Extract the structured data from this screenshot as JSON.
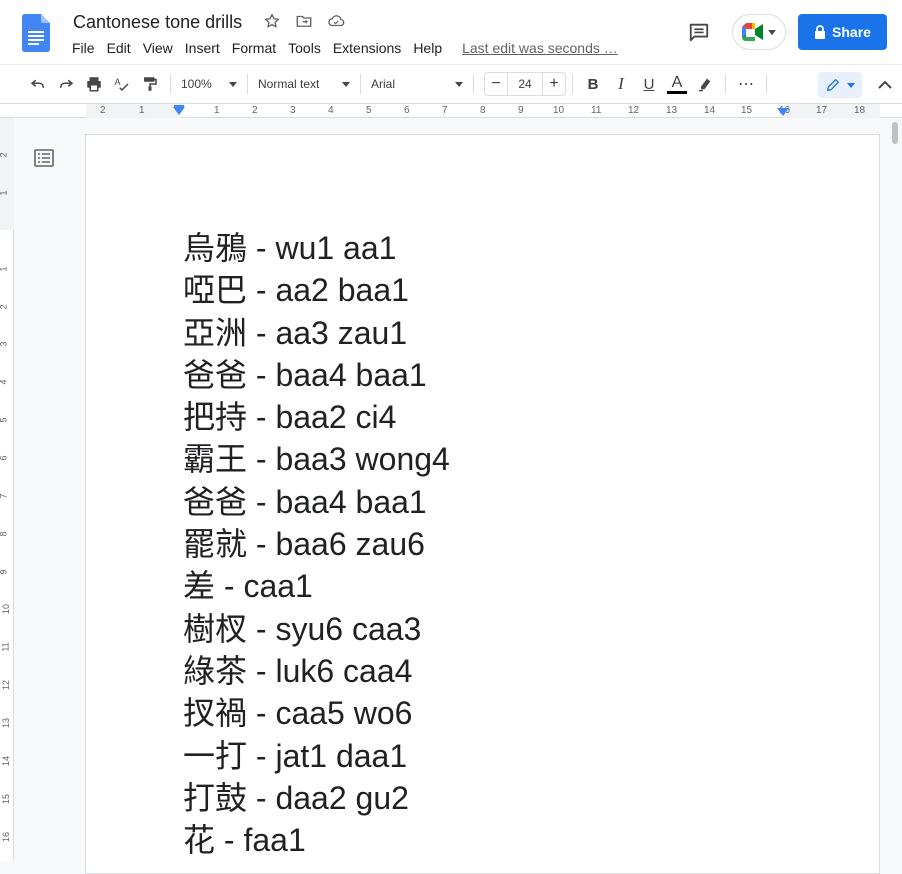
{
  "doc": {
    "title": "Cantonese tone drills",
    "last_edit": "Last edit was seconds …"
  },
  "menu": [
    "File",
    "Edit",
    "View",
    "Insert",
    "Format",
    "Tools",
    "Extensions",
    "Help"
  ],
  "header": {
    "share_label": "Share",
    "icons": [
      "star-icon",
      "move-folder-icon",
      "cloud-saved-icon",
      "comment-history-icon",
      "google-meet-icon",
      "lock-icon"
    ]
  },
  "toolbar": {
    "zoom": "100%",
    "style": "Normal text",
    "font": "Arial",
    "font_size": "24",
    "bold": "B",
    "italic": "I",
    "underline": "U",
    "text_color": "A",
    "more": "⋯"
  },
  "ruler": {
    "h_labels": [
      "2",
      "1",
      "1",
      "2",
      "3",
      "4",
      "5",
      "6",
      "7",
      "8",
      "9",
      "10",
      "11",
      "12",
      "13",
      "14",
      "15",
      "16",
      "17",
      "18"
    ],
    "v_labels": [
      "2",
      "1",
      "1",
      "2",
      "3",
      "4",
      "5",
      "6",
      "7",
      "8",
      "9",
      "10",
      "11",
      "12",
      "13",
      "14",
      "15",
      "16"
    ]
  },
  "lines": [
    {
      "han": "烏鴉",
      "rest": " - wu1 aa1"
    },
    {
      "han": "啞巴",
      "rest": " - aa2 baa1"
    },
    {
      "han": "亞洲",
      "rest": " - aa3 zau1"
    },
    {
      "han": "爸爸",
      "rest": " - baa4 baa1"
    },
    {
      "han": "把持",
      "rest": " - baa2 ci4"
    },
    {
      "han": "霸王",
      "rest": " - baa3 wong4"
    },
    {
      "han": "爸爸",
      "rest": " - baa4 baa1"
    },
    {
      "han": "罷就",
      "rest": " - baa6 zau6"
    },
    {
      "han": "差",
      "rest": " - caa1"
    },
    {
      "han": "樹杈",
      "rest": " - syu6 caa3"
    },
    {
      "han": "綠茶",
      "rest": " - luk6 caa4"
    },
    {
      "han": "扠禍",
      "rest": " - caa5 wo6"
    },
    {
      "han": "一打",
      "rest": " - jat1 daa1"
    },
    {
      "han": "打鼓",
      "rest": " - daa2 gu2"
    },
    {
      "han": "花",
      "rest": " - faa1"
    }
  ],
  "colors": {
    "accent": "#1a73e8",
    "docs_blue": "#4285f4",
    "text": "#202124"
  }
}
